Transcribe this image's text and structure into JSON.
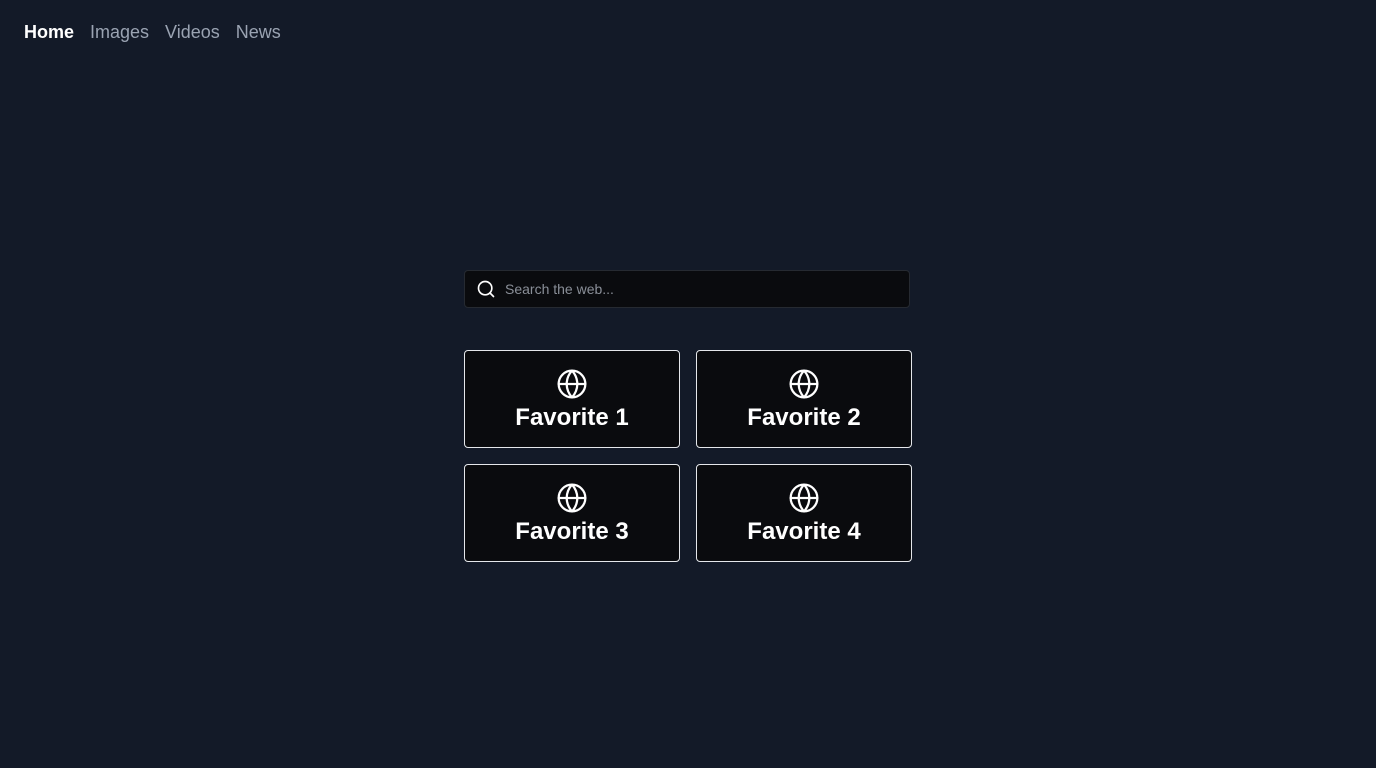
{
  "nav": {
    "items": [
      {
        "label": "Home",
        "active": true
      },
      {
        "label": "Images",
        "active": false
      },
      {
        "label": "Videos",
        "active": false
      },
      {
        "label": "News",
        "active": false
      }
    ]
  },
  "search": {
    "placeholder": "Search the web...",
    "value": "",
    "icon": "search-icon"
  },
  "favorites": [
    {
      "label": "Favorite 1",
      "icon": "globe-icon"
    },
    {
      "label": "Favorite 2",
      "icon": "globe-icon"
    },
    {
      "label": "Favorite 3",
      "icon": "globe-icon"
    },
    {
      "label": "Favorite 4",
      "icon": "globe-icon"
    }
  ],
  "colors": {
    "background": "#131a28",
    "tile_background": "#0a0b0e",
    "tile_border": "#e5e7eb",
    "nav_inactive": "#9aa3b2",
    "nav_active": "#ffffff"
  }
}
